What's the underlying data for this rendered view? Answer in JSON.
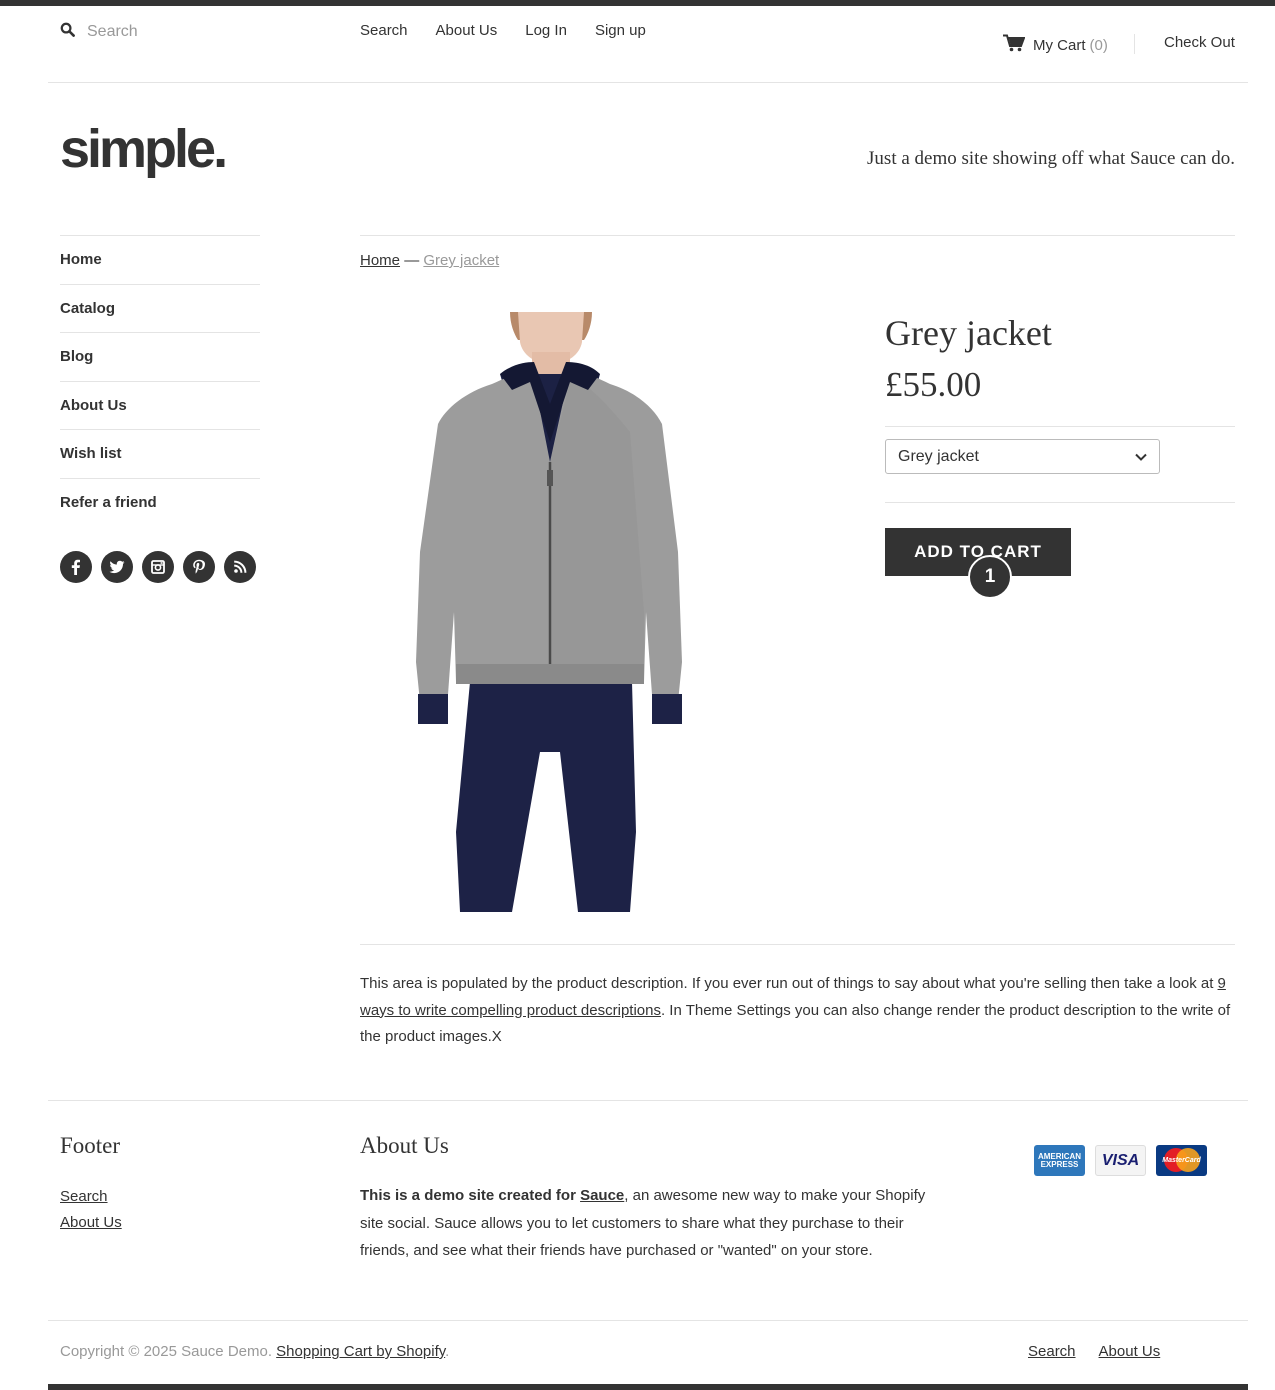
{
  "header": {
    "search_placeholder": "Search",
    "nav": [
      "Search",
      "About Us",
      "Log In",
      "Sign up"
    ],
    "cart_label": "My Cart",
    "cart_count": "(0)",
    "checkout_label": "Check Out"
  },
  "branding": {
    "logo_text": "simple.",
    "tagline": "Just a demo site showing off what Sauce can do."
  },
  "sidebar": {
    "items": [
      {
        "label": "Home"
      },
      {
        "label": "Catalog"
      },
      {
        "label": "Blog"
      },
      {
        "label": "About Us"
      },
      {
        "label": "Wish list"
      },
      {
        "label": "Refer a friend"
      }
    ],
    "social_icons": [
      "facebook-icon",
      "twitter-icon",
      "instagram-icon",
      "pinterest-icon",
      "rss-icon"
    ]
  },
  "breadcrumb": {
    "home": "Home",
    "separator": "—",
    "current": "Grey jacket"
  },
  "product": {
    "title": "Grey jacket",
    "price": "£55.00",
    "variant_selected": "Grey jacket",
    "add_to_cart_label": "ADD TO CART",
    "marker_number": "1",
    "description_before": "This area is populated by the product description. If you ever run out of things to say about what you're selling then take a look at ",
    "description_link": "9 ways to write compelling product descriptions",
    "description_after": ". In Theme Settings you can also change render the product description to the write of the product images.X"
  },
  "footer": {
    "footer_heading": "Footer",
    "links": [
      "Search",
      "About Us"
    ],
    "about_heading": "About Us",
    "about_bold_prefix": "This is a demo site created for ",
    "about_bold_link": "Sauce",
    "about_rest": ", an awesome new way to make your Shopify site social. Sauce allows you to let customers to share what they purchase to their friends, and see what their friends have purchased or \"wanted\" on your store.",
    "payment_cards": {
      "amex_text": "AMERICAN EXPRESS",
      "visa_text": "VISA",
      "mastercard_text": "MasterCard"
    },
    "copyright_text": "Copyright © 2025 Sauce Demo. ",
    "copyright_link": "Shopping Cart by Shopify",
    "copyright_end": ".",
    "bottom_links": [
      "Search",
      "About Us"
    ]
  },
  "colors": {
    "dark": "#333333",
    "muted": "#999999",
    "divider": "#e4e4e4"
  }
}
